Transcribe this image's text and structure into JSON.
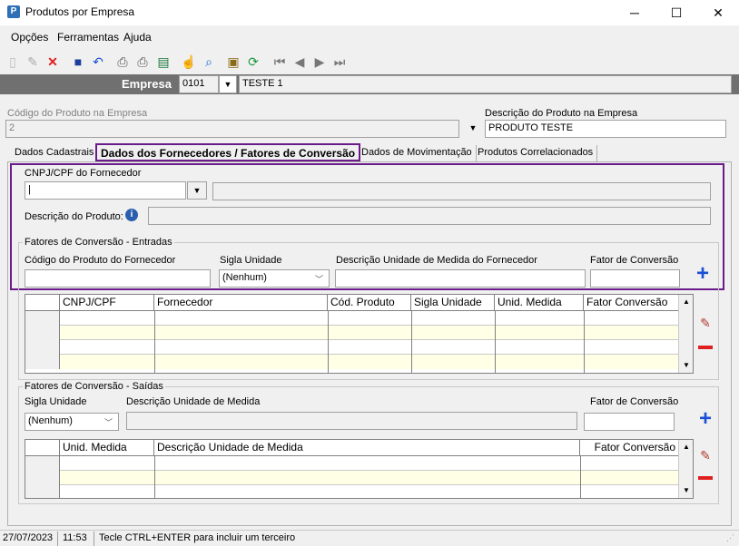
{
  "window": {
    "title": "Produtos por Empresa",
    "app_icon": "P"
  },
  "menu": {
    "items": [
      "Opções",
      "Ferramentas",
      "Ajuda"
    ]
  },
  "empresa": {
    "label": "Empresa",
    "code": "0101",
    "name": "TESTE 1"
  },
  "produto": {
    "codigo_label": "Código do Produto na Empresa",
    "codigo_value": "2",
    "descricao_label": "Descrição do Produto na Empresa",
    "descricao_value": "PRODUTO TESTE"
  },
  "tabs": [
    {
      "label": "Dados Cadastrais"
    },
    {
      "label": "Dados dos Fornecedores / Fatores de Conversão"
    },
    {
      "label": "Dados de Movimentação"
    },
    {
      "label": "Produtos Correlacionados"
    }
  ],
  "fornecedor": {
    "cnpj_label": "CNPJ/CPF do Fornecedor",
    "cnpj_value": "|",
    "descricao_label": "Descrição do Produto:"
  },
  "entradas": {
    "title": "Fatores de Conversão - Entradas",
    "codigo_label": "Código do Produto do Fornecedor",
    "sigla_label": "Sigla Unidade",
    "sigla_value": "(Nenhum)",
    "descricao_label": "Descrição Unidade de Medida do Fornecedor",
    "fator_label": "Fator de Conversão",
    "columns": [
      "CNPJ/CPF",
      "Fornecedor",
      "Cód. Produto",
      "Sigla Unidade",
      "Unid. Medida",
      "Fator Conversão"
    ]
  },
  "saidas": {
    "title": "Fatores de Conversão - Saídas",
    "sigla_label": "Sigla Unidade",
    "sigla_value": "(Nenhum)",
    "descricao_label": "Descrição Unidade de Medida",
    "fator_label": "Fator de Conversão",
    "columns": [
      "Unid. Medida",
      "Descrição Unidade de Medida",
      "Fator Conversão"
    ]
  },
  "status": {
    "date": "27/07/2023",
    "time": "11:53",
    "message": "Tecle CTRL+ENTER para incluir um terceiro"
  },
  "colors": {
    "accent_border": "#6a1b8a",
    "plus": "#1a4fd6",
    "minus": "#e02020",
    "row_yellow": "#ffffe6"
  }
}
